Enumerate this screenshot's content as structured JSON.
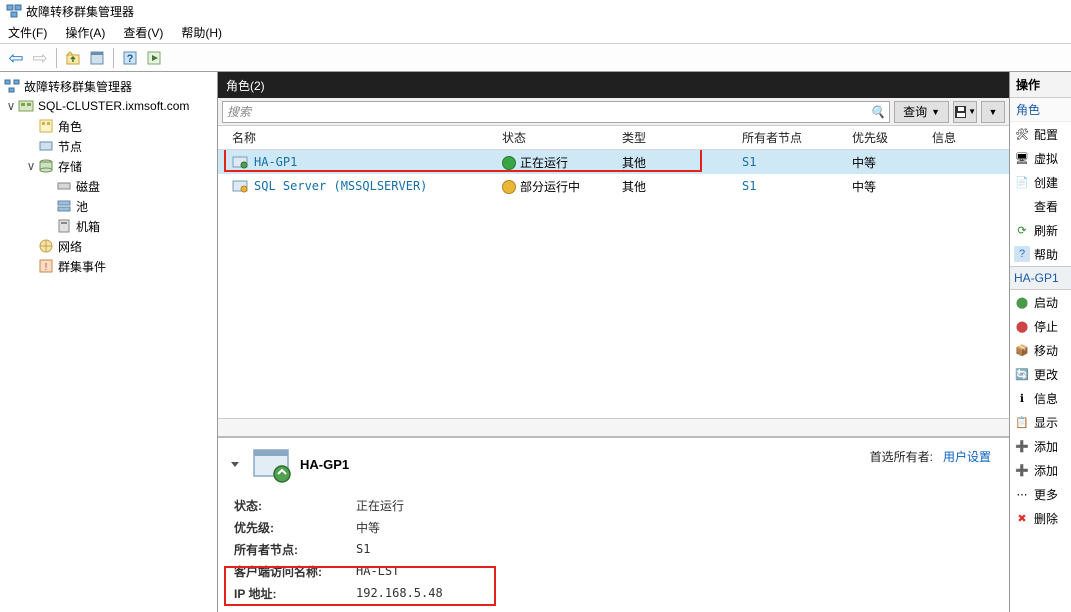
{
  "window": {
    "title": "故障转移群集管理器"
  },
  "menu": {
    "file": "文件(F)",
    "action": "操作(A)",
    "view": "查看(V)",
    "help": "帮助(H)"
  },
  "tree": {
    "root": "故障转移群集管理器",
    "cluster": "SQL-CLUSTER.ixmsoft.com",
    "roles": "角色",
    "nodes": "节点",
    "storage": "存储",
    "disks": "磁盘",
    "pool": "池",
    "machines": "机箱",
    "network": "网络",
    "events": "群集事件"
  },
  "roles_header": "角色(2)",
  "search": {
    "placeholder": "搜索",
    "query_btn": "查询"
  },
  "columns": {
    "name": "名称",
    "status": "状态",
    "type": "类型",
    "owner": "所有者节点",
    "priority": "优先级",
    "info": "信息"
  },
  "rows": [
    {
      "name": "HA-GP1",
      "status": "正在运行",
      "status_kind": "green",
      "type": "其他",
      "owner": "S1",
      "priority": "中等",
      "info": ""
    },
    {
      "name": "SQL Server  (MSSQLSERVER)",
      "status": "部分运行中",
      "status_kind": "warn",
      "type": "其他",
      "owner": "S1",
      "priority": "中等",
      "info": ""
    }
  ],
  "detail": {
    "name": "HA-GP1",
    "pref_owner_label": "首选所有者:",
    "pref_owner_link": "用户设置",
    "kv": {
      "status_k": "状态:",
      "status_v": "正在运行",
      "priority_k": "优先级:",
      "priority_v": "中等",
      "owner_k": "所有者节点:",
      "owner_v": "S1",
      "client_k": "客户端访问名称:",
      "client_v": "HA-LST",
      "ip_k": "IP 地址:",
      "ip_v": "192.168.5.48"
    }
  },
  "actions": {
    "header": "操作",
    "sub": "角色",
    "items1": [
      "配置",
      "虚拟",
      "创建",
      "查看",
      "刷新",
      "帮助"
    ],
    "group": "HA-GP1",
    "items2": [
      "启动",
      "停止",
      "移动",
      "更改",
      "信息",
      "显示",
      "添加",
      "添加",
      "更多",
      "删除"
    ]
  }
}
